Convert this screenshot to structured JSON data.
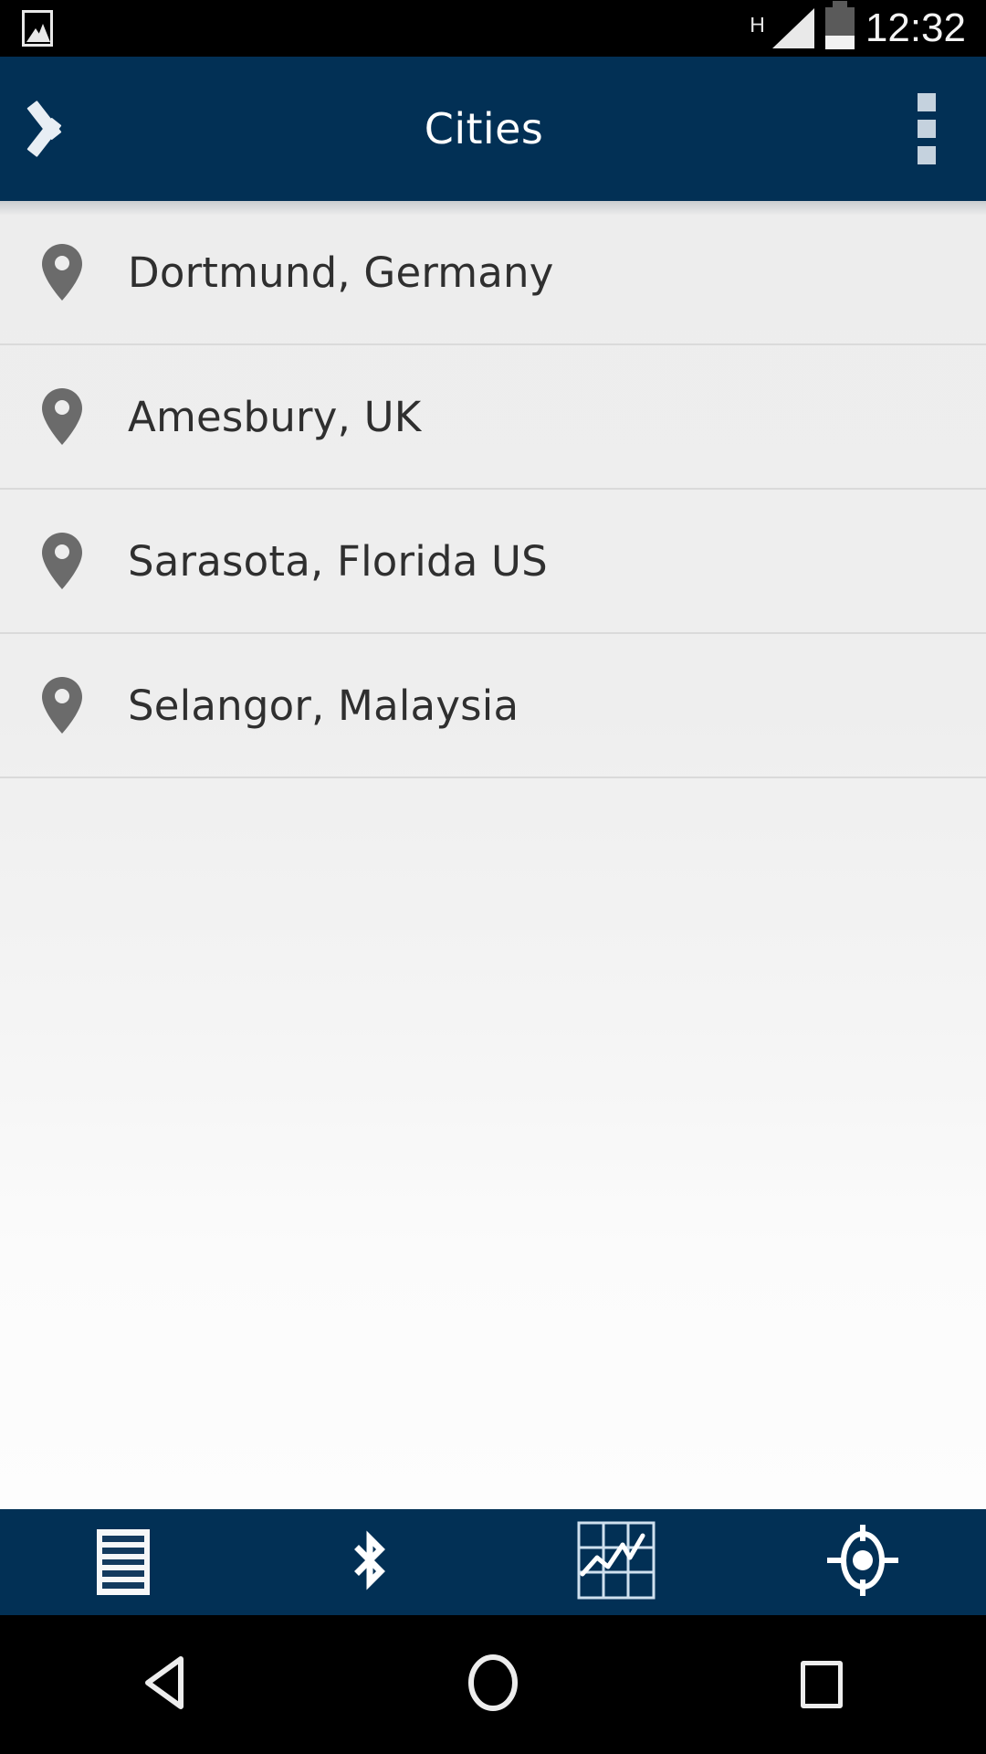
{
  "status_bar": {
    "photo_icon": "photo-icon",
    "network_label": "H",
    "signal_icon": "signal-triangle-icon",
    "battery_icon": "battery-icon",
    "battery_level_percent": 32,
    "time": "12:32"
  },
  "app_bar": {
    "back_icon": "back-chevron-icon",
    "title": "Cities",
    "overflow_icon": "overflow-menu-icon"
  },
  "list": {
    "items": [
      {
        "icon": "map-pin-icon",
        "label": "Dortmund, Germany"
      },
      {
        "icon": "map-pin-icon",
        "label": "Amesbury, UK"
      },
      {
        "icon": "map-pin-icon",
        "label": "Sarasota, Florida US"
      },
      {
        "icon": "map-pin-icon",
        "label": "Selangor, Malaysia"
      }
    ]
  },
  "tab_bar": {
    "active_index": 0,
    "accent_color": "#29a8dd",
    "background_color": "#023055",
    "tabs": [
      {
        "icon": "list-document-icon",
        "name": "tab-list",
        "active": true
      },
      {
        "icon": "bluetooth-icon",
        "name": "tab-bluetooth",
        "active": false
      },
      {
        "icon": "chart-graph-icon",
        "name": "tab-chart",
        "active": false
      },
      {
        "icon": "gps-target-icon",
        "name": "tab-location",
        "active": false
      }
    ]
  },
  "nav_bar": {
    "back_icon": "android-back-icon",
    "home_icon": "android-home-icon",
    "recents_icon": "android-recents-icon"
  },
  "colors": {
    "app_bar": "#023055",
    "accent": "#29a8dd",
    "list_background": "#eeeeee",
    "list_text": "#2f2f2f",
    "pin": "#6b6b6b",
    "divider": "#dadada"
  }
}
